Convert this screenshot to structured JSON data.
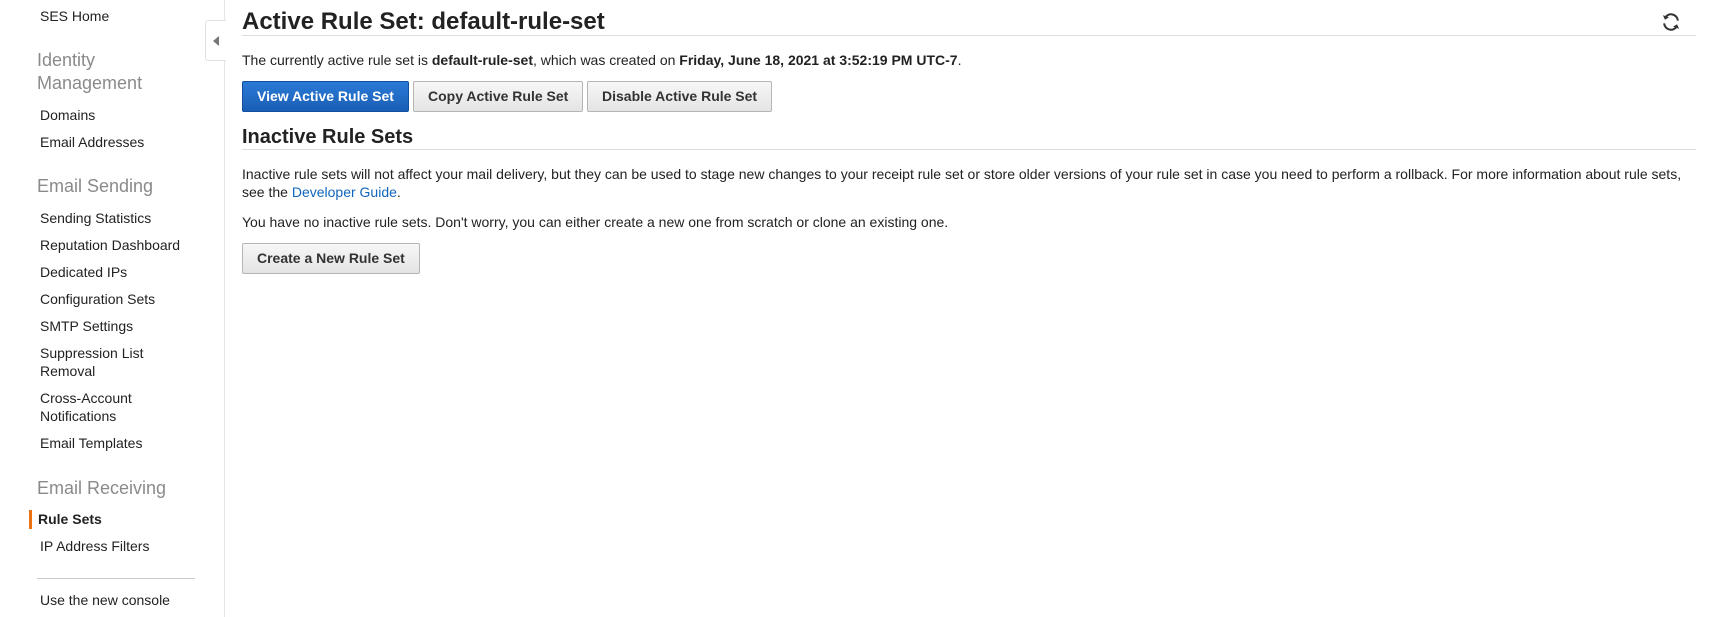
{
  "sidebar": {
    "home": "SES Home",
    "identity_heading": "Identity Management",
    "identity_items": [
      "Domains",
      "Email Addresses"
    ],
    "sending_heading": "Email Sending",
    "sending_items": [
      "Sending Statistics",
      "Reputation Dashboard",
      "Dedicated IPs",
      "Configuration Sets",
      "SMTP Settings",
      "Suppression List Removal",
      "Cross-Account Notifications",
      "Email Templates"
    ],
    "receiving_heading": "Email Receiving",
    "receiving_active": "Rule Sets",
    "receiving_items": [
      "IP Address Filters"
    ],
    "new_console": "Use the new console",
    "accent_color": "#ec7211"
  },
  "main": {
    "title": "Active Rule Set: default-rule-set",
    "active_text": {
      "prefix": "The currently active rule set is ",
      "rule_set_name": "default-rule-set",
      "middle": ", which was created on ",
      "created_on": "Friday, June 18, 2021 at 3:52:19 PM UTC-7",
      "suffix": "."
    },
    "buttons": {
      "view": "View Active Rule Set",
      "copy": "Copy Active Rule Set",
      "disable": "Disable Active Rule Set"
    },
    "inactive_heading": "Inactive Rule Sets",
    "inactive_desc": "Inactive rule sets will not affect your mail delivery, but they can be used to stage new changes to your receipt rule set or store older versions of your rule set in case you need to perform a rollback. For more information about rule sets, see the ",
    "dev_guide_link": "Developer Guide",
    "inactive_desc_end": ".",
    "no_inactive": "You have no inactive rule sets. Don't worry, you can either create a new one from scratch or clone an existing one.",
    "create_button": "Create a New Rule Set",
    "link_color": "#1166bb",
    "primary_color": "#1a5eb5"
  },
  "icons": {
    "collapse": "caret-left-icon",
    "refresh": "refresh-icon"
  }
}
